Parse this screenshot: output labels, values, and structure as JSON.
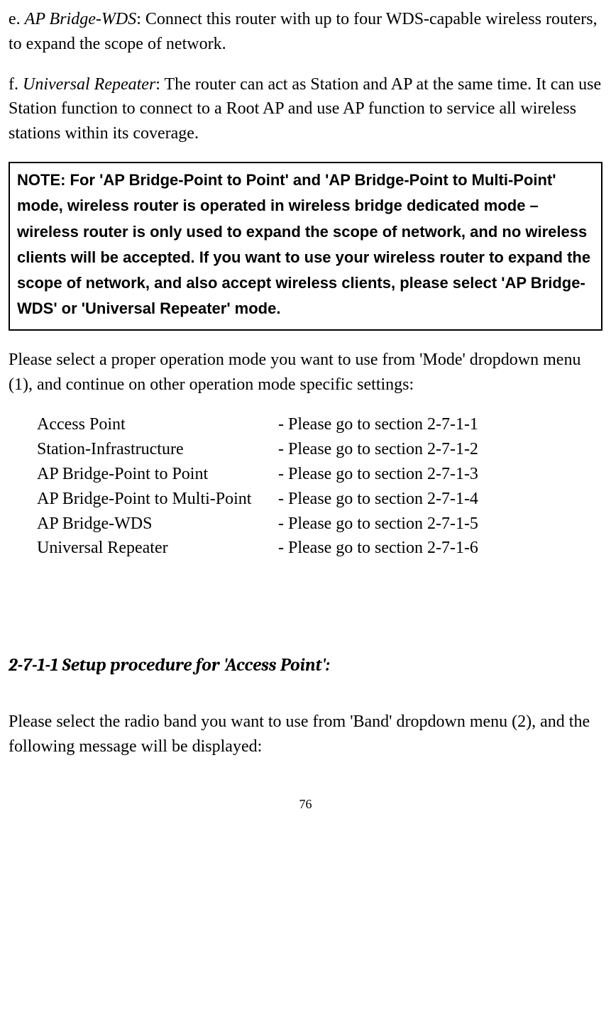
{
  "para_e": {
    "prefix": "e. ",
    "label": "AP Bridge-WDS",
    "text": ": Connect this router with up to four WDS-capable wireless routers, to expand the scope of network."
  },
  "para_f": {
    "prefix": "f. ",
    "label": "Universal Repeater",
    "text": ": The router can act as Station and AP at the same time. It can use Station function to connect to a Root AP and use AP function to service all wireless stations within its coverage."
  },
  "note": "NOTE: For 'AP Bridge-Point to Point' and 'AP Bridge-Point to Multi-Point' mode, wireless router is operated in wireless bridge dedicated mode – wireless router is only used to expand the scope of network, and no wireless clients will be accepted. If you want to use your wireless router to expand the scope of network, and also accept wireless clients, please select 'AP Bridge-WDS' or 'Universal Repeater' mode.",
  "intro": "Please select a proper operation mode you want to use from 'Mode' dropdown menu (1), and continue on other operation mode specific settings:",
  "modes": [
    {
      "name": "Access Point",
      "ref": "- Please go to section 2-7-1-1"
    },
    {
      "name": "Station-Infrastructure",
      "ref": "- Please go to section 2-7-1-2"
    },
    {
      "name": "AP Bridge-Point to Point",
      "ref": "- Please go to section 2-7-1-3"
    },
    {
      "name": "AP Bridge-Point to Multi-Point",
      "ref": "- Please go to section 2-7-1-4"
    },
    {
      "name": "AP Bridge-WDS",
      "ref": "- Please go to section 2-7-1-5"
    },
    {
      "name": "Universal Repeater",
      "ref": "- Please go to section 2-7-1-6"
    }
  ],
  "section_heading": "2-7-1-1 Setup procedure for 'Access Point':",
  "closing": "Please select the radio band you want to use from 'Band' dropdown menu (2), and the following message will be displayed:",
  "page_number": "76"
}
